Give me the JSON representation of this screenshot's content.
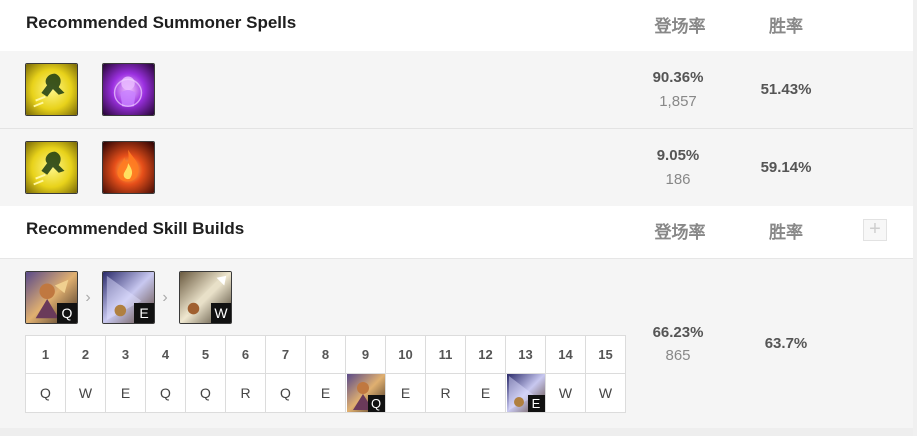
{
  "spells_section": {
    "title": "Recommended Summoner Spells",
    "col_pick": "登场率",
    "col_win": "胜率",
    "rows": [
      {
        "spell1_icon": "ghost-spell-icon",
        "spell2_icon": "cleanse-spell-icon",
        "pick_rate": "90.36%",
        "pick_count": "1,857",
        "win_rate": "51.43%"
      },
      {
        "spell1_icon": "ghost-spell-icon",
        "spell2_icon": "ignite-spell-icon",
        "pick_rate": "9.05%",
        "pick_count": "186",
        "win_rate": "59.14%"
      }
    ]
  },
  "skills_section": {
    "title": "Recommended Skill Builds",
    "col_pick": "登场率",
    "col_win": "胜率",
    "add_label": "+",
    "priority": [
      {
        "key": "Q",
        "icon": "skill-q-icon"
      },
      {
        "key": "E",
        "icon": "skill-e-icon"
      },
      {
        "key": "W",
        "icon": "skill-w-icon"
      }
    ],
    "levels": [
      "1",
      "2",
      "3",
      "4",
      "5",
      "6",
      "7",
      "8",
      "9",
      "10",
      "11",
      "12",
      "13",
      "14",
      "15"
    ],
    "order": [
      "Q",
      "W",
      "E",
      "Q",
      "Q",
      "R",
      "Q",
      "E",
      "Q",
      "E",
      "R",
      "E",
      "E",
      "W",
      "W"
    ],
    "pick_rate": "66.23%",
    "pick_count": "865",
    "win_rate": "63.7%"
  },
  "colors": {
    "row_bg": "#f5f5f5",
    "header_text": "#1e1e1e",
    "muted_text": "#888888",
    "ghost_yellow": "#e8d21a",
    "cleanse_purple": "#8a2be2",
    "ignite_red": "#c8321a"
  }
}
